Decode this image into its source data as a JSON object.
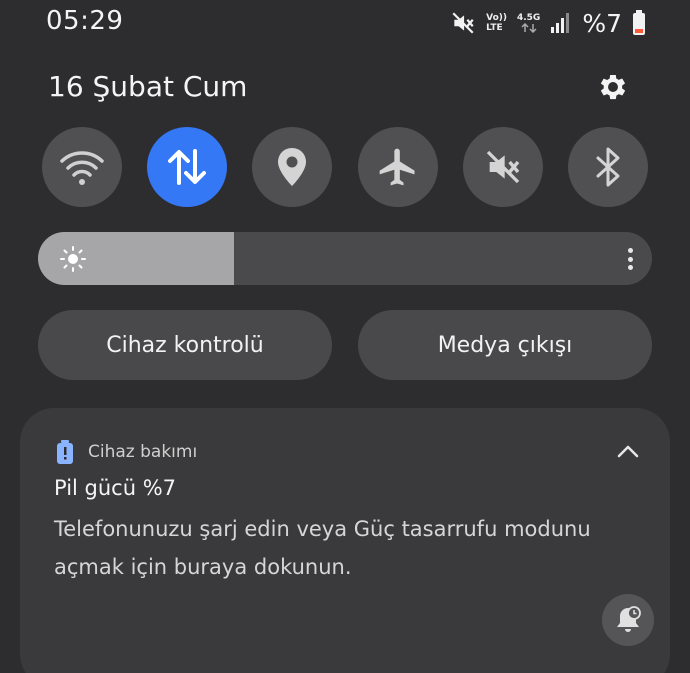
{
  "status_bar": {
    "time": "05:29",
    "volte_top": "Vo))",
    "volte_bottom": "LTE",
    "network_type": "4.5G",
    "battery": "%7",
    "icons": [
      "mute-icon",
      "volte-icon",
      "network-arrows-icon",
      "signal-icon",
      "battery-low-icon"
    ]
  },
  "header": {
    "date": "16 Şubat Cum",
    "settings_icon": "gear-icon"
  },
  "quick_toggles": [
    {
      "name": "wifi",
      "icon": "wifi-icon",
      "active": false
    },
    {
      "name": "mobile-data",
      "icon": "data-arrows-icon",
      "active": true
    },
    {
      "name": "location",
      "icon": "location-pin-icon",
      "active": false
    },
    {
      "name": "airplane",
      "icon": "airplane-icon",
      "active": false
    },
    {
      "name": "sound",
      "icon": "mute-icon",
      "active": false
    },
    {
      "name": "bluetooth",
      "icon": "bluetooth-icon",
      "active": false
    }
  ],
  "brightness": {
    "level": 0.32
  },
  "buttons": {
    "device_control": "Cihaz kontrolü",
    "media_output": "Medya çıkışı"
  },
  "notification": {
    "app_name": "Cihaz bakımı",
    "title": "Pil gücü %7",
    "body": "Telefonunuzu şarj edin veya Güç tasarrufu modunu açmak için buraya dokunun.",
    "colors": {
      "accent": "#3478f6",
      "app_icon": "#8ab4ff"
    }
  }
}
